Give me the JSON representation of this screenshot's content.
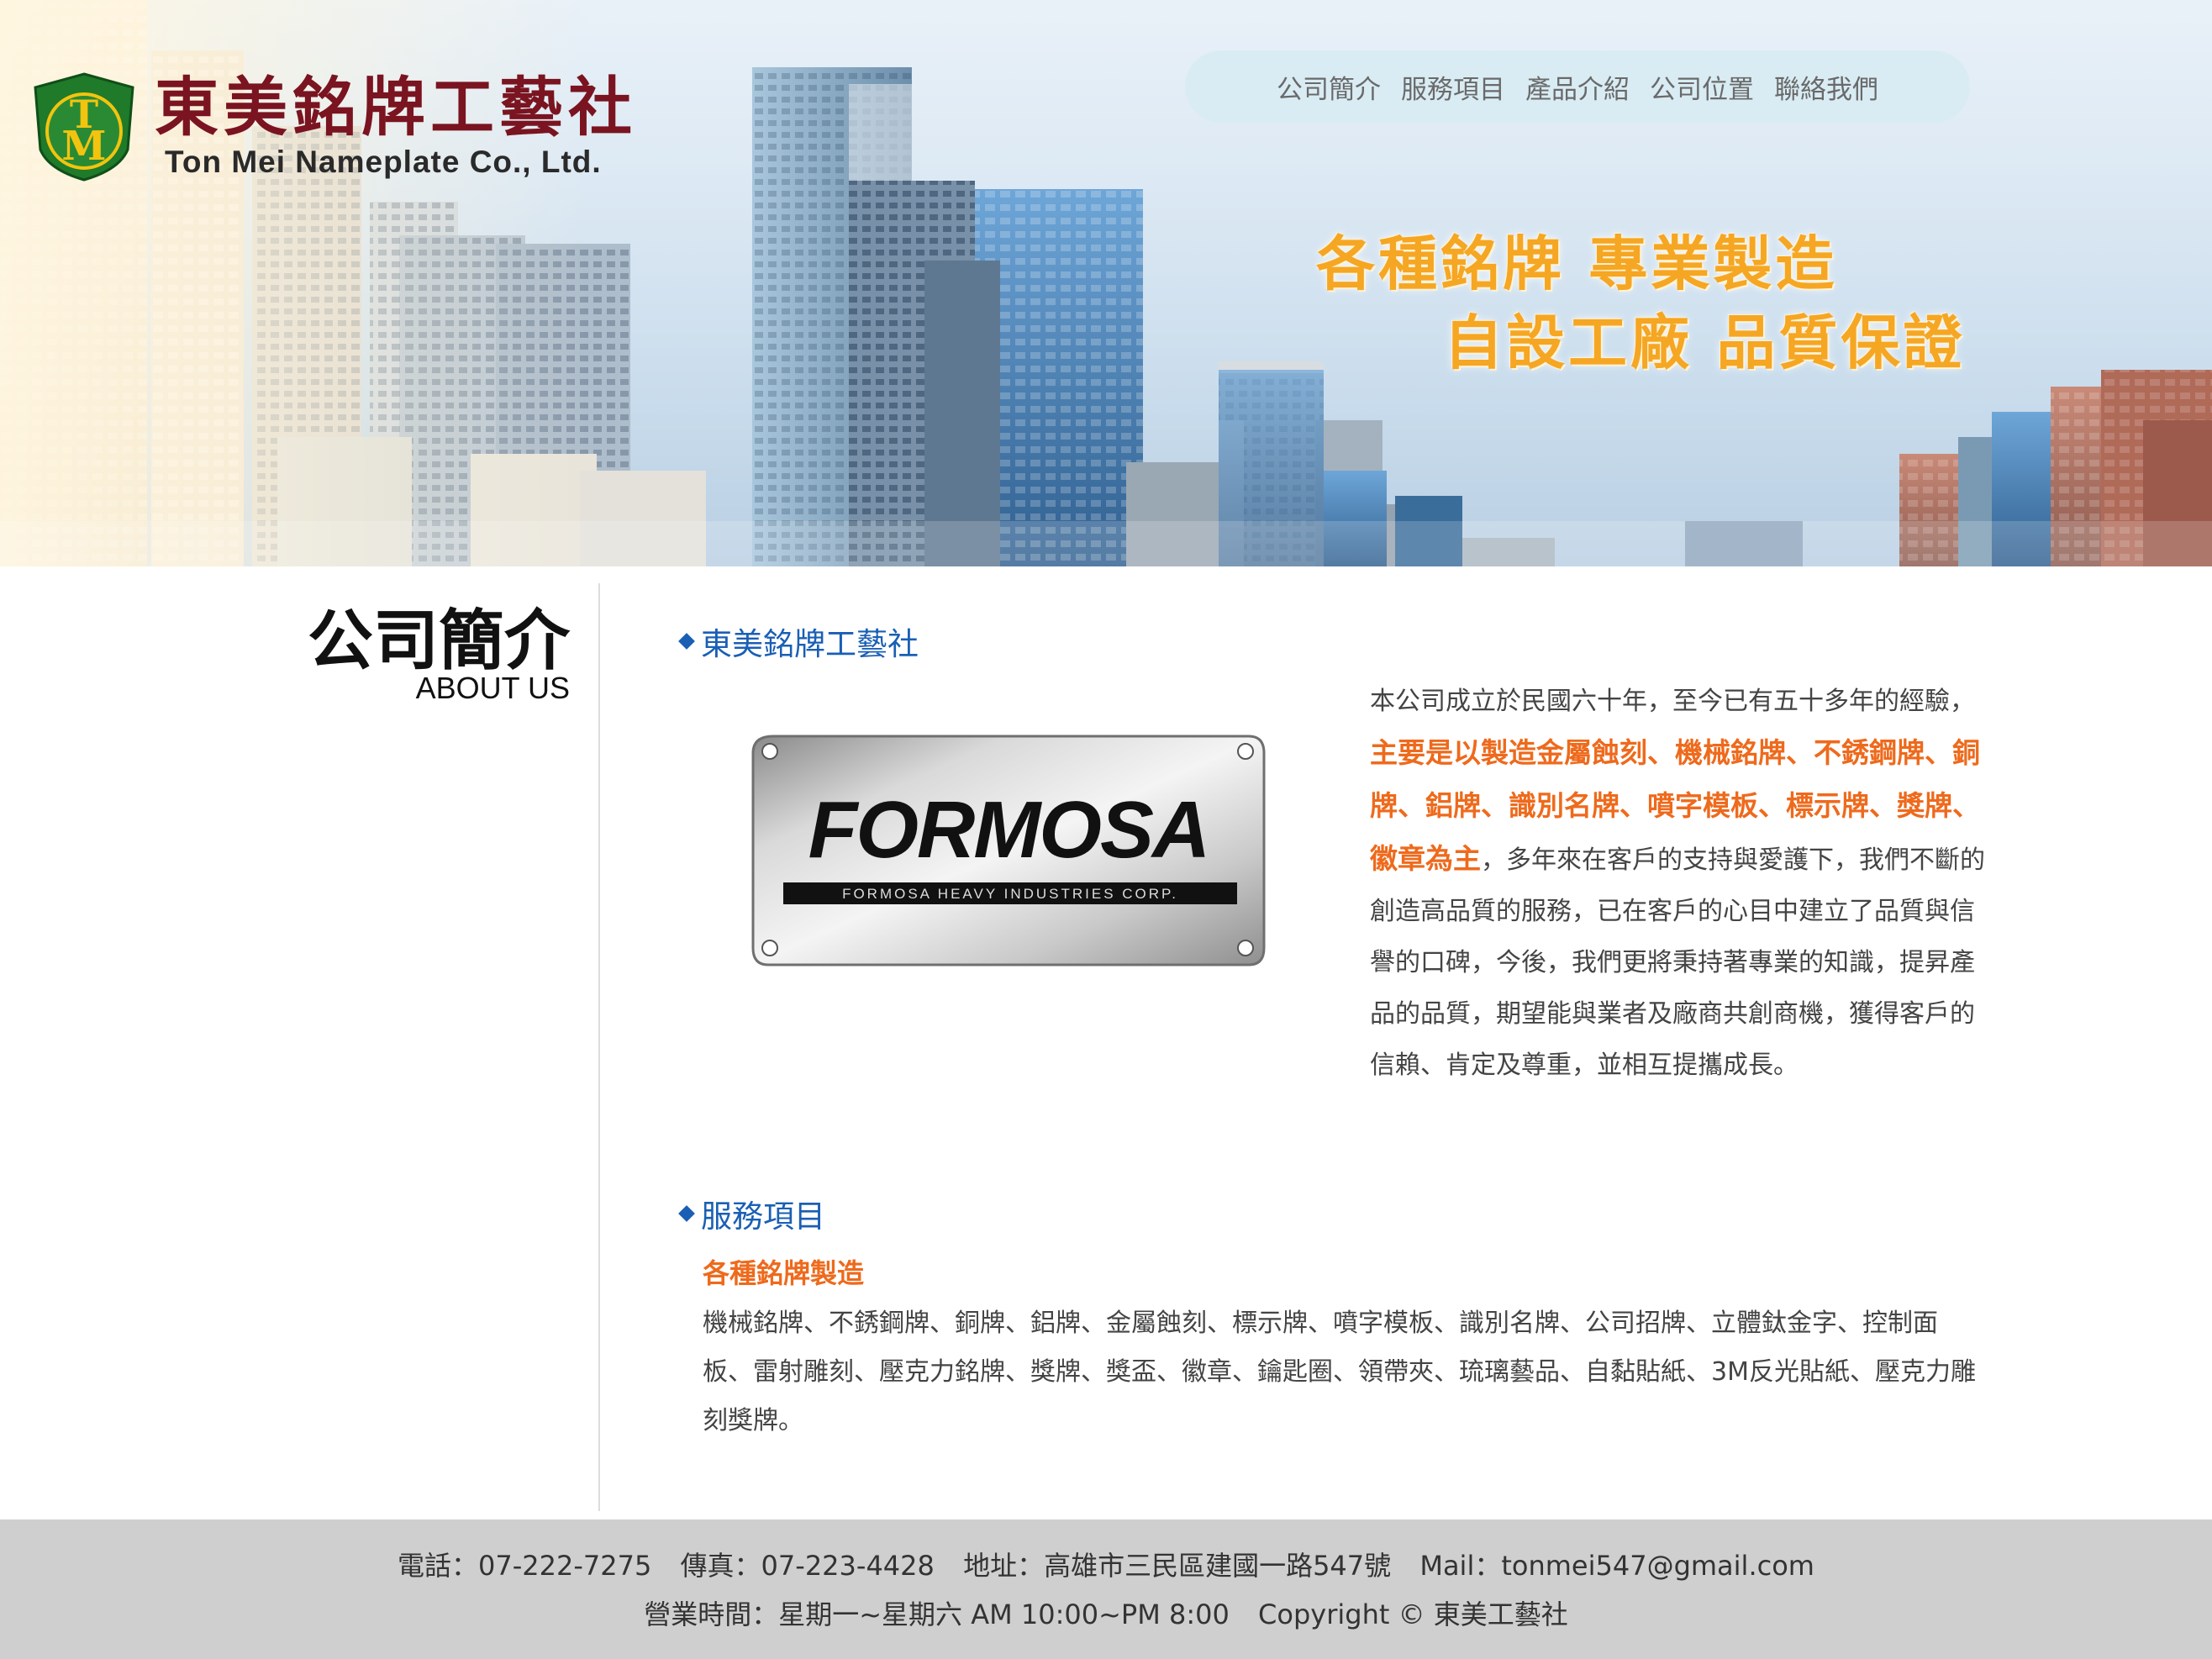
{
  "brand": {
    "badge_letters": "TM",
    "name_cn": "東美銘牌工藝社",
    "name_en": "Ton Mei Nameplate Co., Ltd."
  },
  "nav": {
    "items": [
      {
        "label": "公司簡介"
      },
      {
        "label": "服務項目"
      },
      {
        "label": "產品介紹"
      },
      {
        "label": "公司位置"
      },
      {
        "label": "聯絡我們"
      }
    ]
  },
  "slogan": {
    "line1": "各種銘牌  專業製造",
    "line2": "自設工廠  品質保證"
  },
  "side": {
    "title_cn": "公司簡介",
    "title_en": "ABOUT US"
  },
  "about": {
    "heading": "東美銘牌工藝社",
    "plate_brand": "FORMOSA",
    "plate_subtitle": "FORMOSA HEAVY INDUSTRIES CORP.",
    "text_intro": "本公司成立於民國六十年，至今已有五十多年的經驗，",
    "text_highlight": "主要是以製造金屬蝕刻、機械銘牌、不銹鋼牌、銅牌、鋁牌、識別名牌、噴字模板、標示牌、獎牌、徽章為主",
    "text_rest": "，多年來在客戶的支持與愛護下，我們不斷的創造高品質的服務，已在客戶的心目中建立了品質與信譽的口碑，今後，我們更將秉持著專業的知識，提昇產品的品質，期望能與業者及廠商共創商機，獲得客戶的信賴、肯定及尊重，並相互提攜成長。"
  },
  "service": {
    "heading": "服務項目",
    "subheading": "各種銘牌製造",
    "text": "機械銘牌、不銹鋼牌、銅牌、鋁牌、金屬蝕刻、標示牌、噴字模板、識別名牌、公司招牌、立體鈦金字、控制面板、雷射雕刻、壓克力銘牌、獎牌、獎盃、徽章、鑰匙圈、領帶夾、琉璃藝品、自黏貼紙、3M反光貼紙、壓克力雕刻獎牌。"
  },
  "footer": {
    "phone": "電話：07-222-7275",
    "fax": "傳真：07-223-4428",
    "address": "地址：高雄市三民區建國一路547號",
    "mail": "Mail：tonmei547@gmail.com",
    "hours": "營業時間：星期一~星期六 AM 10:00~PM 8:00",
    "copyright": "Copyright © 東美工藝社"
  },
  "colors": {
    "brand_red": "#7a1420",
    "badge_green": "#1f7a2a",
    "badge_gold": "#f2c40f",
    "heading_blue": "#1a5fb4",
    "highlight_orange": "#ee6a1c",
    "slogan_orange": "#f5a623",
    "footer_bg": "#cfcfcf"
  }
}
